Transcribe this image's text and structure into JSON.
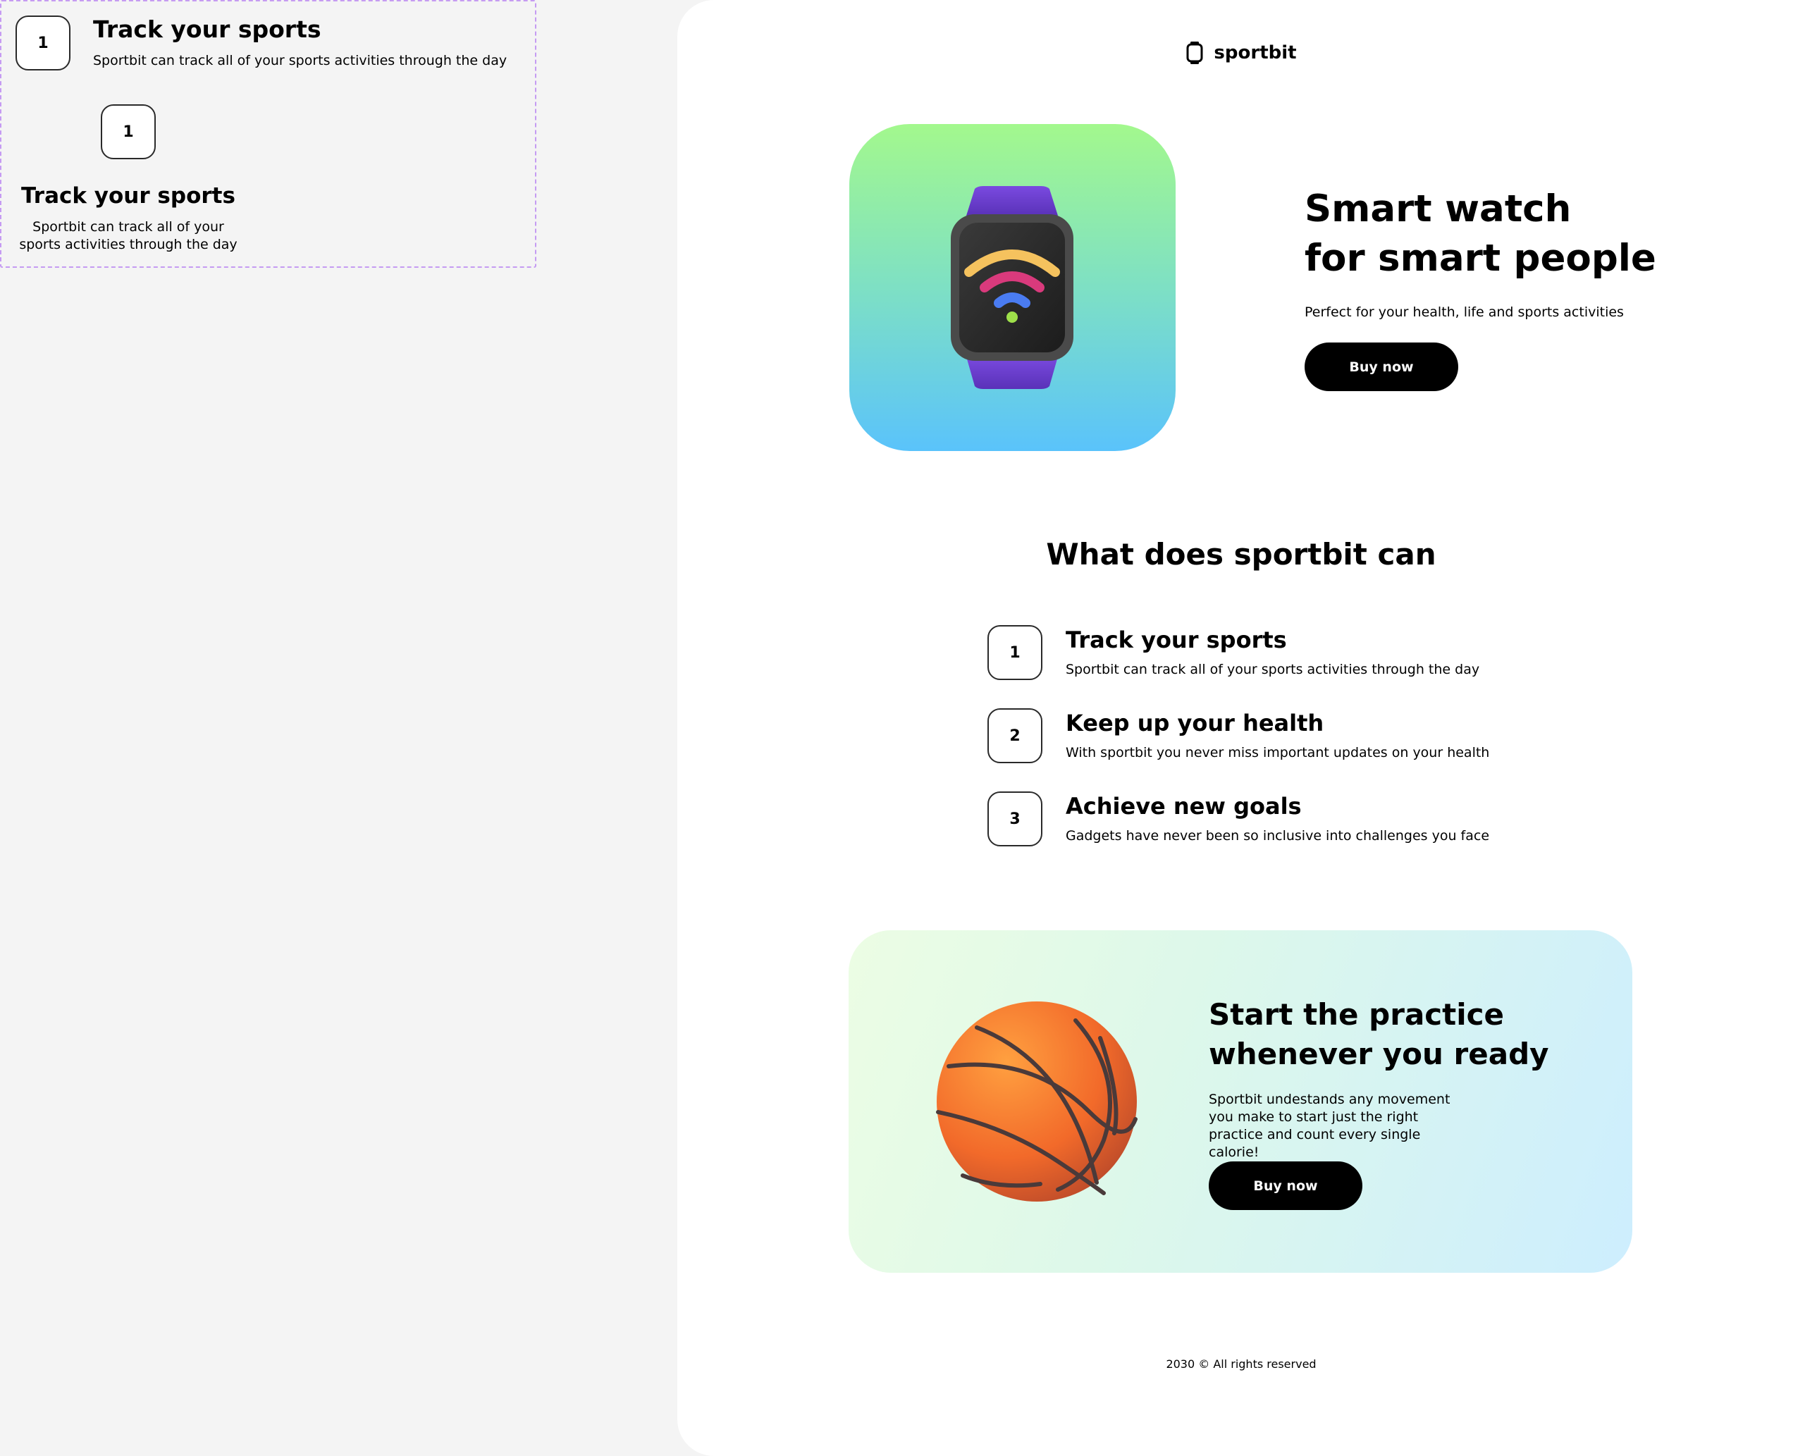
{
  "components_panel": {
    "horizontal_item": {
      "number": "1",
      "title": "Track your sports",
      "description": "Sportbit can track all of your sports activities through the day"
    },
    "stacked_item": {
      "number": "1",
      "title": "Track your sports",
      "description": "Sportbit can track all of your sports activities through the day"
    }
  },
  "header": {
    "brand": "sportbit",
    "brand_icon": "watch-icon"
  },
  "hero": {
    "title_line1": "Smart watch",
    "title_line2": "for smart people",
    "subtitle": "Perfect for your health, life and sports activities",
    "button_label": "Buy now",
    "image": "smartwatch-illustration",
    "image_gradient": [
      "#a3f88d",
      "#5ac3fb"
    ]
  },
  "features": {
    "title": "What does sportbit can",
    "items": [
      {
        "number": "1",
        "title": "Track your sports",
        "description": "Sportbit can track all of your sports activities through the day"
      },
      {
        "number": "2",
        "title": "Keep up your health",
        "description": "With sportbit you never miss important updates on your health"
      },
      {
        "number": "3",
        "title": "Achieve new goals",
        "description": "Gadgets have never been so inclusive into challenges you face"
      }
    ]
  },
  "cta": {
    "title_line1": "Start the practice",
    "title_line2": "whenever you ready",
    "description": "Sportbit undestands any movement you make to start just the right practice and count every single calorie!",
    "button_label": "Buy now",
    "image": "basketball-illustration"
  },
  "footer": {
    "copyright": "2030 © All rights reserved"
  },
  "colors": {
    "page_bg": "#f4f4f4",
    "card_bg": "#ffffff",
    "button_bg": "#000000",
    "component_border": "#c59bf2"
  }
}
